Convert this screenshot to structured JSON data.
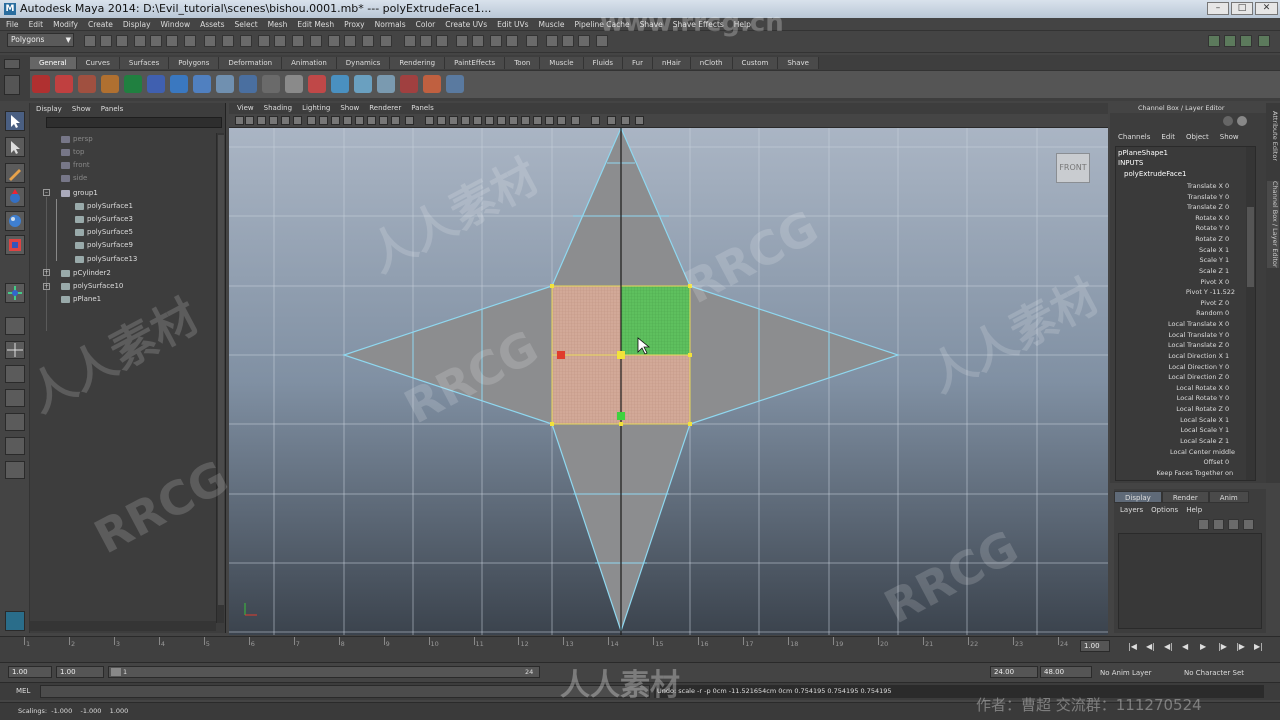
{
  "title": "Autodesk Maya 2014: D:\\Evil_tutorial\\scenes\\bishou.0001.mb*   ---   polyExtrudeFace1...",
  "menu": [
    "File",
    "Edit",
    "Modify",
    "Create",
    "Display",
    "Window",
    "Assets",
    "Select",
    "Mesh",
    "Edit Mesh",
    "Proxy",
    "Normals",
    "Color",
    "Create UVs",
    "Edit UVs",
    "Muscle",
    "Pipeline Cache",
    "Shave",
    "Shave Effects",
    "Help"
  ],
  "mode_selector": "Polygons",
  "shelf_tabs": [
    "General",
    "Curves",
    "Surfaces",
    "Polygons",
    "Deformation",
    "Animation",
    "Dynamics",
    "Rendering",
    "PaintEffects",
    "Toon",
    "Muscle",
    "Fluids",
    "Fur",
    "nHair",
    "nCloth",
    "Custom",
    "Shave"
  ],
  "outliner": {
    "menu": [
      "Display",
      "Show",
      "Panels"
    ],
    "items": [
      "persp",
      "top",
      "front",
      "side",
      "group1",
      "polySurface1",
      "polySurface3",
      "polySurface5",
      "polySurface9",
      "polySurface13",
      "pCylinder2",
      "polySurface10",
      "pPlane1"
    ]
  },
  "viewport": {
    "menu": [
      "View",
      "Shading",
      "Lighting",
      "Show",
      "Renderer",
      "Panels"
    ],
    "view_label": "FRONT"
  },
  "channel_box": {
    "title": "Channel Box / Layer Editor",
    "menu": [
      "Channels",
      "Edit",
      "Object",
      "Show"
    ],
    "object": "pPlaneShape1",
    "inputs_label": "INPUTS",
    "node": "polyExtrudeFace1",
    "attrs": [
      {
        "name": "Translate X",
        "value": "0"
      },
      {
        "name": "Translate Y",
        "value": "0"
      },
      {
        "name": "Translate Z",
        "value": "0"
      },
      {
        "name": "Rotate X",
        "value": "0"
      },
      {
        "name": "Rotate Y",
        "value": "0"
      },
      {
        "name": "Rotate Z",
        "value": "0"
      },
      {
        "name": "Scale X",
        "value": "1"
      },
      {
        "name": "Scale Y",
        "value": "1"
      },
      {
        "name": "Scale Z",
        "value": "1"
      },
      {
        "name": "Pivot X",
        "value": "0"
      },
      {
        "name": "Pivot Y",
        "value": "-11.522"
      },
      {
        "name": "Pivot Z",
        "value": "0"
      },
      {
        "name": "Random",
        "value": "0"
      },
      {
        "name": "Local Translate X",
        "value": "0"
      },
      {
        "name": "Local Translate Y",
        "value": "0"
      },
      {
        "name": "Local Translate Z",
        "value": "0"
      },
      {
        "name": "Local Direction X",
        "value": "1"
      },
      {
        "name": "Local Direction Y",
        "value": "0"
      },
      {
        "name": "Local Direction Z",
        "value": "0"
      },
      {
        "name": "Local Rotate X",
        "value": "0"
      },
      {
        "name": "Local Rotate Y",
        "value": "0"
      },
      {
        "name": "Local Rotate Z",
        "value": "0"
      },
      {
        "name": "Local Scale X",
        "value": "1"
      },
      {
        "name": "Local Scale Y",
        "value": "1"
      },
      {
        "name": "Local Scale Z",
        "value": "1"
      },
      {
        "name": "Local Center",
        "value": "middle"
      },
      {
        "name": "Offset",
        "value": "0"
      },
      {
        "name": "Keep Faces Together",
        "value": "on"
      }
    ],
    "side_tabs": [
      "Attribute Editor",
      "Channel Box / Layer Editor"
    ]
  },
  "layer_editor": {
    "tabs": [
      "Display",
      "Render",
      "Anim"
    ],
    "menu": [
      "Layers",
      "Options",
      "Help"
    ]
  },
  "timeline": {
    "ticks": [
      "1",
      "2",
      "3",
      "4",
      "5",
      "6",
      "7",
      "8",
      "9",
      "10",
      "11",
      "12",
      "13",
      "14",
      "15",
      "16",
      "17",
      "18",
      "19",
      "20",
      "21",
      "22",
      "23",
      "24"
    ],
    "current_frame": "1.00"
  },
  "range": {
    "start": "1.00",
    "playback_start": "1.00",
    "slider_start": "1",
    "slider_end": "24",
    "playback_end": "24.00",
    "end": "48.00",
    "anim_layer": "No Anim Layer",
    "char_set": "No Character Set"
  },
  "command_line": {
    "label": "MEL",
    "feedback": "Undo: scale -r -p 0cm -11.521654cm 0cm 0.754195 0.754195 0.754195"
  },
  "help_line": {
    "text": "Scalings:  -1.000    -1.000    1.000"
  },
  "watermark": {
    "site": "www.rrcg.cn",
    "brand": "RRCG",
    "cn": "人人素材",
    "author": "作者：曹超   交流群：111270524"
  },
  "colors": {
    "selected_face": "#5ec05e",
    "face_orange": "#d9a88e",
    "vertex_yellow": "#f2e23a",
    "pivot_red": "#e03c2c"
  }
}
